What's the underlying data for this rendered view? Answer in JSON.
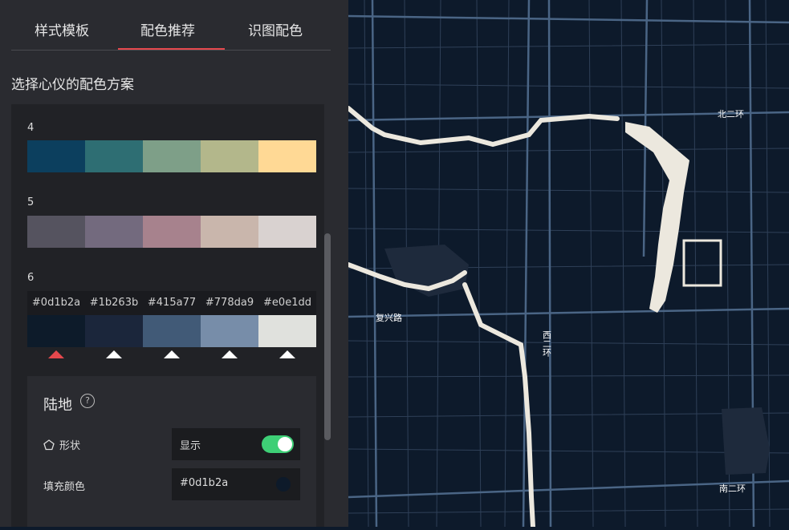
{
  "tabs": [
    "样式模板",
    "配色推荐",
    "识图配色"
  ],
  "active_tab": "配色推荐",
  "subtitle": "选择心仪的配色方案",
  "schemes": [
    {
      "label": "4",
      "colors": [
        "#0c3f5e",
        "#2e6e73",
        "#7e9f88",
        "#b3b78b",
        "#ffd995"
      ]
    },
    {
      "label": "5",
      "colors": [
        "#55535f",
        "#736a7e",
        "#a7828d",
        "#c9b6ac",
        "#d9d2d0"
      ]
    },
    {
      "label": "6",
      "colors": [
        "#0d1b2a",
        "#1b263b",
        "#415a77",
        "#778da9",
        "#e0e1dd"
      ],
      "hex": [
        "#0d1b2a",
        "#1b263b",
        "#415a77",
        "#778da9",
        "#e0e1dd"
      ]
    }
  ],
  "land": {
    "title": "陆地",
    "help_icon": "question-circle-icon",
    "shape_icon": "pentagon-icon",
    "shape_label": "形状",
    "shape_value": "显示",
    "fill_label": "填充颜色",
    "fill_value": "#0d1b2a"
  },
  "map": {
    "road_labels": [
      "北二环",
      "复兴路",
      "西二环",
      "南二环"
    ]
  },
  "accent_color": "#e5484d",
  "toggle_color": "#3ecf76"
}
